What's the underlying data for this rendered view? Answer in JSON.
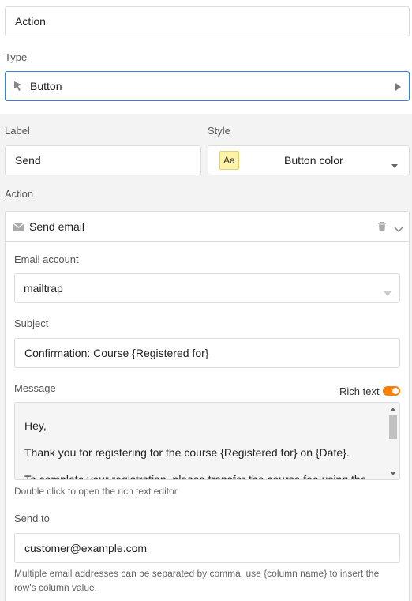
{
  "action_name": {
    "value": "Action"
  },
  "type": {
    "label": "Type",
    "value": "Button",
    "icon": "cursor-icon"
  },
  "label_field": {
    "label": "Label",
    "value": "Send"
  },
  "style_field": {
    "label": "Style",
    "swatch_text": "Aa",
    "value": "Button color",
    "swatch_color": "#fff3a6"
  },
  "action_section": {
    "label": "Action"
  },
  "action_card": {
    "title": "Send email",
    "email_account": {
      "label": "Email account",
      "value": "mailtrap"
    },
    "subject": {
      "label": "Subject",
      "value": "Confirmation: Course {Registered for}"
    },
    "message": {
      "label": "Message",
      "rich_text_label": "Rich text",
      "rich_text_enabled": true,
      "lines": [
        "Hey,",
        "Thank you for registering for the course {Registered for} on {Date}.",
        "To complete your registration, please transfer the course fee using the"
      ],
      "help": "Double click to open the rich text editor"
    },
    "send_to": {
      "label": "Send to",
      "value": "customer@example.com",
      "help_line1": "Multiple email addresses can be separated by comma, use {column name} to insert the",
      "help_line2": "row's column value."
    }
  },
  "colors": {
    "accent": "#ff8000",
    "focus_border": "#3b7ddd"
  }
}
